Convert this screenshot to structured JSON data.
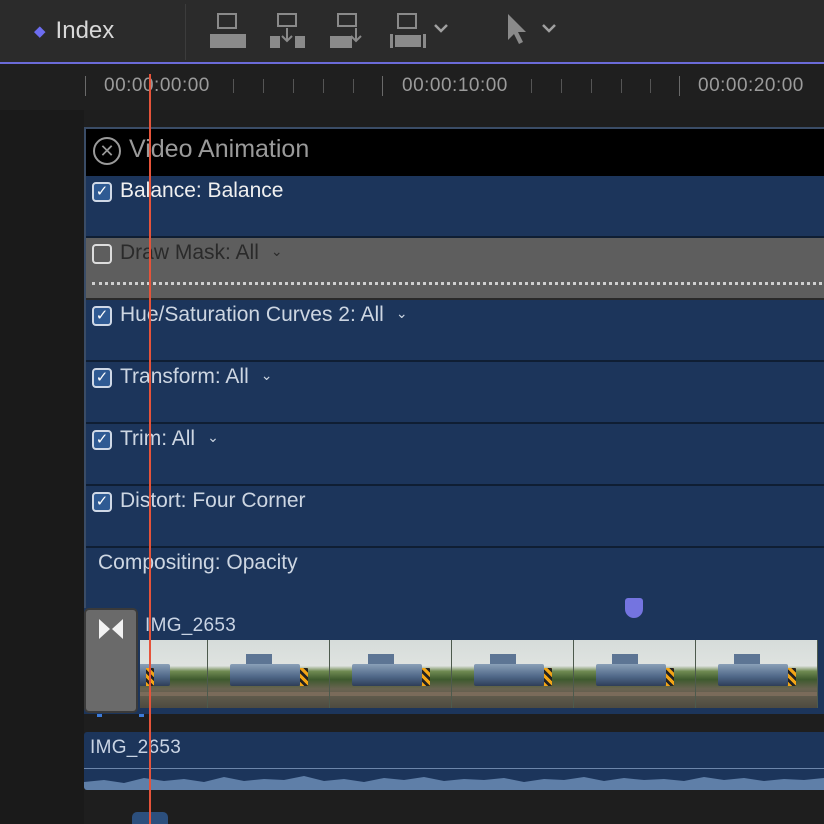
{
  "toolbar": {
    "index_label": "Index",
    "icons": [
      "append-clip-icon",
      "insert-clip-icon",
      "connect-clip-icon",
      "overwrite-clip-icon",
      "select-tool-icon"
    ]
  },
  "ruler": {
    "timecodes": [
      "00:00:00:00",
      "00:00:10:00",
      "00:00:20:00"
    ]
  },
  "video_animation": {
    "title": "Video Animation",
    "rows": [
      {
        "label": "Balance: Balance",
        "checked": true,
        "has_menu": false
      },
      {
        "label": "Draw Mask: All",
        "checked": false,
        "has_menu": true
      },
      {
        "label": "Hue/Saturation Curves 2: All",
        "checked": true,
        "has_menu": true
      },
      {
        "label": "Transform: All",
        "checked": true,
        "has_menu": true
      },
      {
        "label": "Trim: All",
        "checked": true,
        "has_menu": true
      },
      {
        "label": "Distort: Four Corner",
        "checked": true,
        "has_menu": false
      },
      {
        "label": "Compositing: Opacity",
        "checked": null,
        "has_menu": false
      }
    ]
  },
  "clip": {
    "name": "IMG_2653",
    "frame_count": 6
  },
  "audio": {
    "name": "IMG_2653"
  },
  "colors": {
    "accent": "#6d6df0",
    "clip_blue": "#1c355b",
    "playhead": "#e5533a",
    "disabled_row": "#5e5e5e"
  }
}
